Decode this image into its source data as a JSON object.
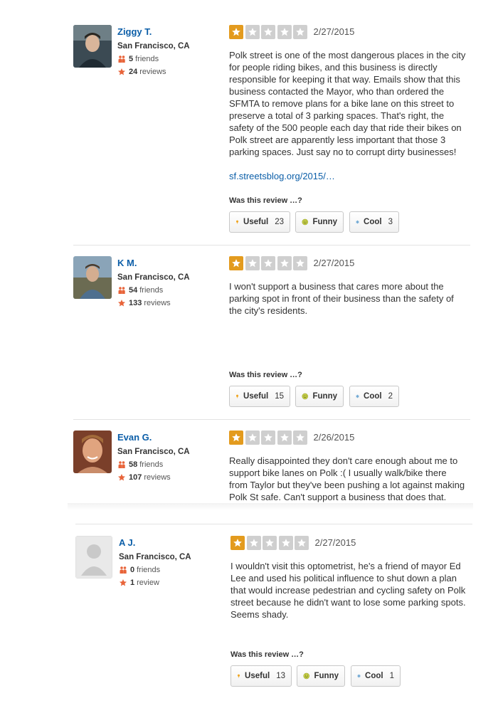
{
  "vote_prompt": "Was this review …?",
  "vote_labels": {
    "useful": "Useful",
    "funny": "Funny",
    "cool": "Cool"
  },
  "colors": {
    "name_link": "#0b5ea8",
    "star_on": "#e39b1e",
    "star_off": "#cfcfcf",
    "friends_icon": "#e8643a",
    "review_star_icon": "#e8643a"
  },
  "reviews": [
    {
      "name": "Ziggy T.",
      "location": "San Francisco, CA",
      "friends_count": "5",
      "friends_label": "friends",
      "reviews_count": "24",
      "reviews_label": "reviews",
      "rating": 1,
      "date": "2/27/2015",
      "text": "Polk street is one of the most dangerous places in the city for people riding bikes, and this business is directly responsible for keeping it that way.  Emails show that this business contacted the Mayor, who than ordered the SFMTA to remove plans for a bike lane on this street to preserve a total of 3 parking spaces.  That's right, the safety of the 500 people each day that ride their bikes on Polk street are apparently less important that those 3 parking spaces.  Just say no to corrupt dirty businesses!",
      "link": "sf.streetsblog.org/2015/…",
      "useful": "23",
      "cool": "3"
    },
    {
      "name": "K M.",
      "location": "San Francisco, CA",
      "friends_count": "54",
      "friends_label": "friends",
      "reviews_count": "133",
      "reviews_label": "reviews",
      "rating": 1,
      "date": "2/27/2015",
      "text": "I won't support a business that cares more about the parking spot in front of their business than the safety of the city's residents.",
      "useful": "15",
      "cool": "2"
    },
    {
      "name": "Evan G.",
      "location": "San Francisco, CA",
      "friends_count": "58",
      "friends_label": "friends",
      "reviews_count": "107",
      "reviews_label": "reviews",
      "rating": 1,
      "date": "2/26/2015",
      "text": "Really disappointed they don't care enough about me to support bike lanes on Polk :( I usually walk/bike there from Taylor but they've been pushing a lot against making Polk St safe. Can't support a business that does that."
    },
    {
      "name": "A J.",
      "location": "San Francisco, CA",
      "friends_count": "0",
      "friends_label": "friends",
      "reviews_count": "1",
      "reviews_label": "review",
      "rating": 1,
      "date": "2/27/2015",
      "text": "I wouldn't visit this optometrist, he's a friend of mayor Ed Lee and used his political influence to shut down a plan that would increase pedestrian and cycling safety on Polk street because he didn't want to lose some parking spots. Seems shady.",
      "useful": "13",
      "cool": "1"
    }
  ]
}
